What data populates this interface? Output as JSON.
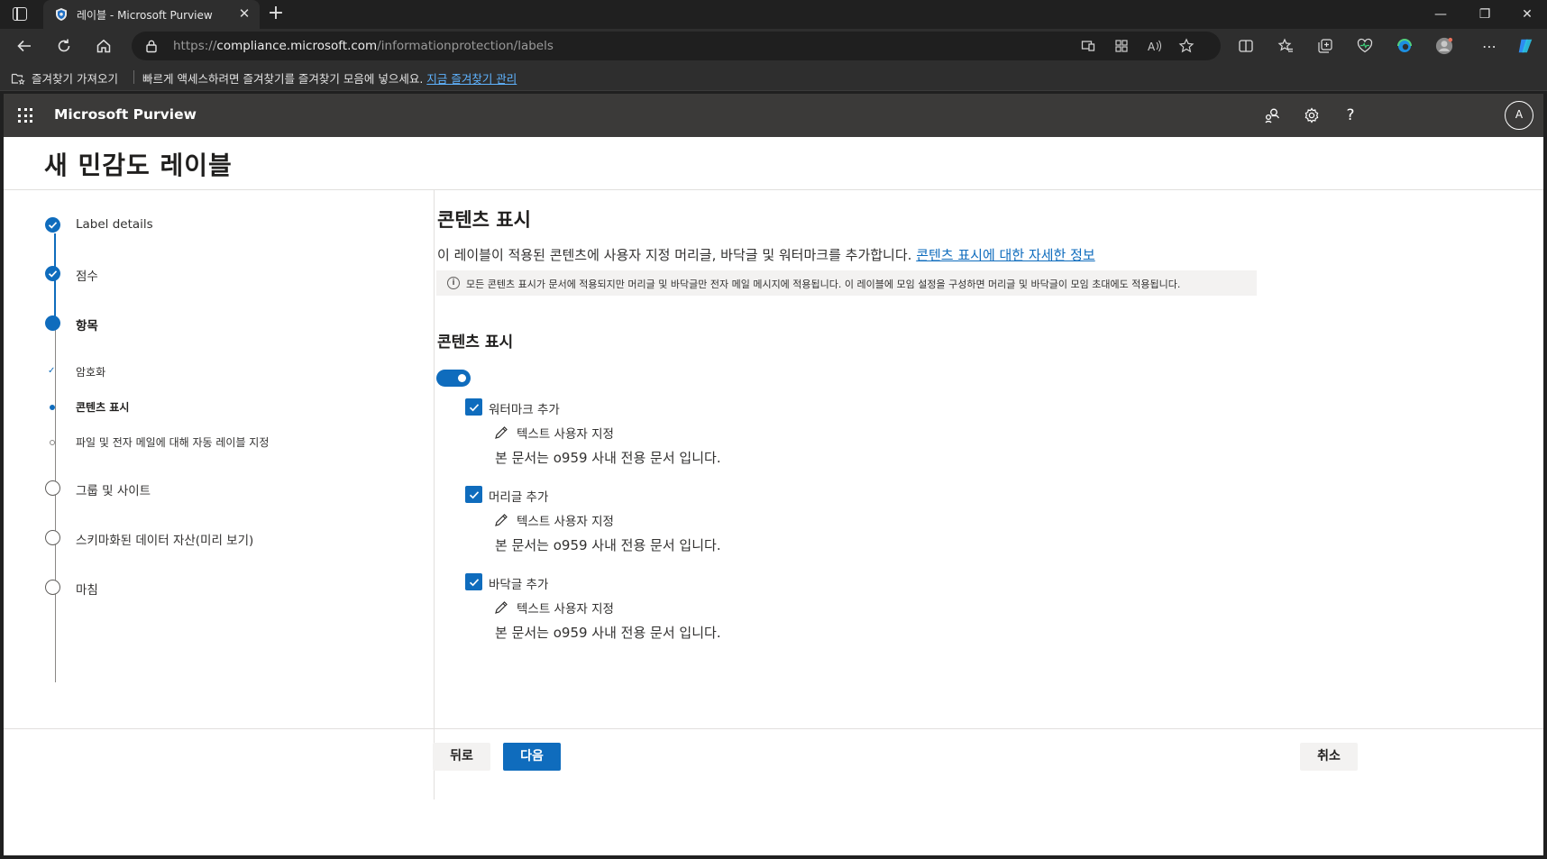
{
  "browser": {
    "tab_title": "레이블 - Microsoft Purview",
    "url_scheme": "https://",
    "url_host": "compliance.microsoft.com",
    "url_path": "/informationprotection/labels",
    "favorites_import": "즐겨찾기 가져오기",
    "favorites_message": "빠르게 액세스하려면 즐겨찾기를 즐겨찾기 모음에 넣으세요.",
    "favorites_manage_link": "지금 즐겨찾기 관리",
    "new_tab_glyph": "+",
    "close_glyph": "✕",
    "minimize_glyph": "—",
    "restore_glyph": "❐",
    "more_glyph": "⋯"
  },
  "app": {
    "name": "Microsoft Purview",
    "help_glyph": "?",
    "avatar_initial": "A"
  },
  "page": {
    "title": "새 민감도 레이블"
  },
  "steps": [
    {
      "label": "Label details",
      "state": "done"
    },
    {
      "label": "점수",
      "state": "done"
    },
    {
      "label": "항목",
      "state": "current"
    },
    {
      "label": "그룹 및 사이트",
      "state": "todo"
    },
    {
      "label": "스키마화된 데이터 자산(미리 보기)",
      "state": "todo"
    },
    {
      "label": "마침",
      "state": "todo"
    }
  ],
  "substeps": [
    {
      "label": "암호화",
      "state": "done"
    },
    {
      "label": "콘텐츠 표시",
      "state": "current"
    },
    {
      "label": "파일 및 전자 메일에 대해 자동 레이블 지정",
      "state": "todo"
    }
  ],
  "content": {
    "heading": "콘텐츠 표시",
    "description": "이 레이블이 적용된 콘텐츠에 사용자 지정 머리글, 바닥글 및 워터마크를 추가합니다.",
    "learn_more_link": "콘텐츠 표시에 대한 자세한 정보",
    "info_text": "모든 콘텐츠 표시가 문서에 적용되지만 머리글 및 바닥글만 전자 메일 메시지에 적용됩니다. 이 레이블에 모임 설정을 구성하면 머리글 및 바닥글이 모임 초대에도 적용됩니다.",
    "info_glyph": "i",
    "section_heading": "콘텐츠 표시",
    "toggle_on": true,
    "markings": [
      {
        "label": "워터마크 추가",
        "checked": true,
        "edit_label": "텍스트 사용자 지정",
        "text": "본 문서는 o959 사내 전용 문서 입니다."
      },
      {
        "label": "머리글 추가",
        "checked": true,
        "edit_label": "텍스트 사용자 지정",
        "text": "본 문서는 o959 사내 전용 문서 입니다."
      },
      {
        "label": "바닥글 추가",
        "checked": true,
        "edit_label": "텍스트 사용자 지정",
        "text": "본 문서는 o959 사내 전용 문서 입니다."
      }
    ]
  },
  "footer": {
    "back_label": "뒤로",
    "next_label": "다음",
    "cancel_label": "취소"
  },
  "colors": {
    "accent": "#0f6cbd",
    "header_bg": "#3b3a39",
    "browser_bg": "#202020"
  }
}
